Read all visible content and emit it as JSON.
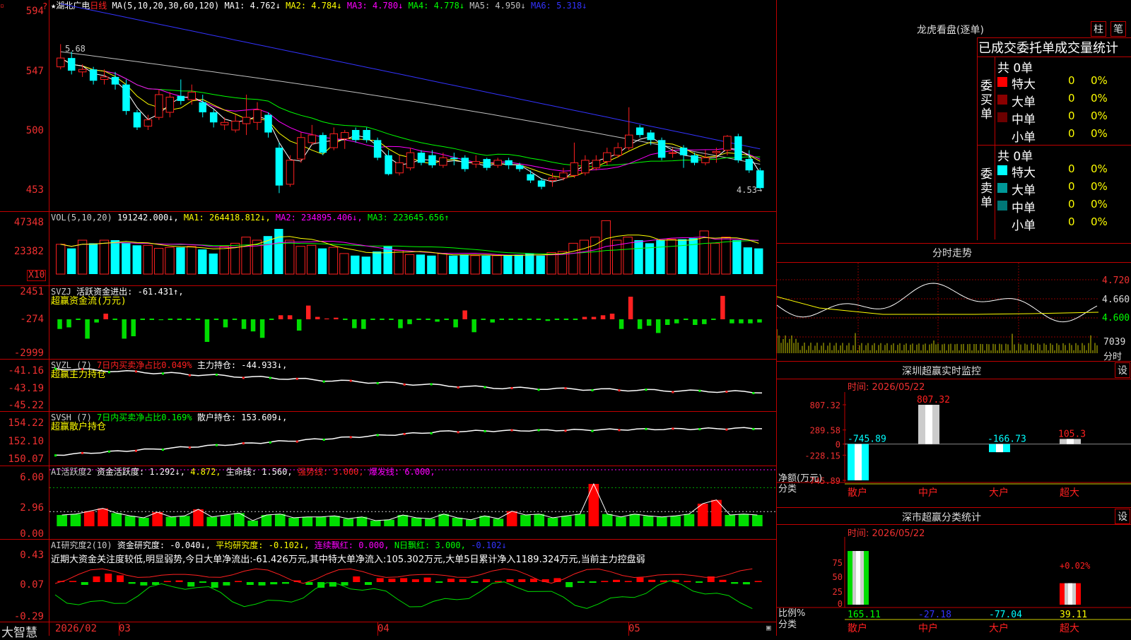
{
  "kline": {
    "star": "★",
    "name": "湖北广电",
    "period": "日线",
    "ma_label": "MA(5,10,20,30,60,120)",
    "ma": [
      {
        "label": "MA1: 4.762↓",
        "color": "#ffffff"
      },
      {
        "label": "MA2: 4.784↓",
        "color": "#ffff00"
      },
      {
        "label": "MA3: 4.780↓",
        "color": "#ff00ff"
      },
      {
        "label": "MA4: 4.778↓",
        "color": "#00ff00"
      },
      {
        "label": "MA5: 4.950↓",
        "color": "#c0c0c0"
      },
      {
        "label": "MA6: 5.318↓",
        "color": "#3333ff"
      }
    ],
    "y_ticks": [
      "594",
      "547",
      "500",
      "453"
    ],
    "high_mark": "5.68",
    "low_mark": "4.53→",
    "candles": [
      {
        "o": 5.5,
        "c": 5.57,
        "h": 5.68,
        "l": 5.48
      },
      {
        "o": 5.57,
        "c": 5.47,
        "h": 5.62,
        "l": 5.44
      },
      {
        "o": 5.46,
        "c": 5.48,
        "h": 5.52,
        "l": 5.42
      },
      {
        "o": 5.48,
        "c": 5.39,
        "h": 5.5,
        "l": 5.36
      },
      {
        "o": 5.4,
        "c": 5.42,
        "h": 5.48,
        "l": 5.36
      },
      {
        "o": 5.42,
        "c": 5.36,
        "h": 5.46,
        "l": 5.32
      },
      {
        "o": 5.36,
        "c": 5.15,
        "h": 5.4,
        "l": 5.12
      },
      {
        "o": 5.14,
        "c": 5.02,
        "h": 5.16,
        "l": 5.0
      },
      {
        "o": 5.03,
        "c": 5.08,
        "h": 5.12,
        "l": 5.0
      },
      {
        "o": 5.1,
        "c": 5.28,
        "h": 5.32,
        "l": 5.08
      },
      {
        "o": 5.14,
        "c": 5.26,
        "h": 5.3,
        "l": 5.1
      },
      {
        "o": 5.27,
        "c": 5.23,
        "h": 5.4,
        "l": 5.2
      },
      {
        "o": 5.24,
        "c": 5.3,
        "h": 5.36,
        "l": 5.2
      },
      {
        "o": 5.22,
        "c": 5.14,
        "h": 5.28,
        "l": 5.1
      },
      {
        "o": 5.14,
        "c": 5.06,
        "h": 5.16,
        "l": 5.02
      },
      {
        "o": 5.04,
        "c": 5.06,
        "h": 5.1,
        "l": 5.0
      },
      {
        "o": 5.0,
        "c": 5.07,
        "h": 5.12,
        "l": 4.98
      },
      {
        "o": 5.05,
        "c": 5.1,
        "h": 5.28,
        "l": 4.96
      },
      {
        "o": 5.06,
        "c": 5.16,
        "h": 5.22,
        "l": 5.0
      },
      {
        "o": 5.12,
        "c": 4.98,
        "h": 5.14,
        "l": 4.94
      },
      {
        "o": 4.86,
        "c": 4.56,
        "h": 4.9,
        "l": 4.5
      },
      {
        "o": 4.57,
        "c": 4.76,
        "h": 4.8,
        "l": 4.55
      },
      {
        "o": 4.77,
        "c": 4.94,
        "h": 4.98,
        "l": 4.74
      },
      {
        "o": 4.9,
        "c": 4.96,
        "h": 5.04,
        "l": 4.88
      },
      {
        "o": 4.96,
        "c": 4.82,
        "h": 4.98,
        "l": 4.8
      },
      {
        "o": 4.86,
        "c": 4.97,
        "h": 5.02,
        "l": 4.84
      },
      {
        "o": 4.93,
        "c": 4.98,
        "h": 5.0,
        "l": 4.85
      },
      {
        "o": 5.0,
        "c": 4.92,
        "h": 5.02,
        "l": 4.9
      },
      {
        "o": 5.0,
        "c": 4.92,
        "h": 5.02,
        "l": 4.9
      },
      {
        "o": 4.92,
        "c": 4.78,
        "h": 4.94,
        "l": 4.76
      },
      {
        "o": 4.8,
        "c": 4.65,
        "h": 4.84,
        "l": 4.64
      },
      {
        "o": 4.66,
        "c": 4.74,
        "h": 4.8,
        "l": 4.64
      },
      {
        "o": 4.7,
        "c": 4.82,
        "h": 4.86,
        "l": 4.68
      },
      {
        "o": 4.82,
        "c": 4.74,
        "h": 4.84,
        "l": 4.72
      },
      {
        "o": 4.8,
        "c": 4.72,
        "h": 4.84,
        "l": 4.7
      },
      {
        "o": 4.72,
        "c": 4.78,
        "h": 4.82,
        "l": 4.7
      },
      {
        "o": 4.78,
        "c": 4.77,
        "h": 4.82,
        "l": 4.72
      },
      {
        "o": 4.78,
        "c": 4.69,
        "h": 4.8,
        "l": 4.67
      },
      {
        "o": 4.73,
        "c": 4.75,
        "h": 4.8,
        "l": 4.7
      },
      {
        "o": 4.77,
        "c": 4.7,
        "h": 4.78,
        "l": 4.68
      },
      {
        "o": 4.72,
        "c": 4.76,
        "h": 4.78,
        "l": 4.7
      },
      {
        "o": 4.76,
        "c": 4.72,
        "h": 4.78,
        "l": 4.69
      },
      {
        "o": 4.72,
        "c": 4.69,
        "h": 4.74,
        "l": 4.67
      },
      {
        "o": 4.65,
        "c": 4.6,
        "h": 4.68,
        "l": 4.58
      },
      {
        "o": 4.6,
        "c": 4.55,
        "h": 4.62,
        "l": 4.53
      },
      {
        "o": 4.6,
        "c": 4.62,
        "h": 4.66,
        "l": 4.55
      },
      {
        "o": 4.62,
        "c": 4.66,
        "h": 4.7,
        "l": 4.6
      },
      {
        "o": 4.64,
        "c": 4.74,
        "h": 4.9,
        "l": 4.62
      },
      {
        "o": 4.66,
        "c": 4.76,
        "h": 4.8,
        "l": 4.64
      },
      {
        "o": 4.7,
        "c": 4.76,
        "h": 4.8,
        "l": 4.68
      },
      {
        "o": 4.75,
        "c": 4.82,
        "h": 4.86,
        "l": 4.72
      },
      {
        "o": 4.8,
        "c": 4.86,
        "h": 4.9,
        "l": 4.78
      },
      {
        "o": 4.86,
        "c": 4.96,
        "h": 5.18,
        "l": 4.84
      },
      {
        "o": 5.02,
        "c": 4.96,
        "h": 5.04,
        "l": 4.94
      },
      {
        "o": 4.98,
        "c": 4.92,
        "h": 5.0,
        "l": 4.88
      },
      {
        "o": 4.92,
        "c": 4.78,
        "h": 4.94,
        "l": 4.76
      },
      {
        "o": 4.82,
        "c": 4.82,
        "h": 4.86,
        "l": 4.78
      },
      {
        "o": 4.86,
        "c": 4.8,
        "h": 4.88,
        "l": 4.7
      },
      {
        "o": 4.8,
        "c": 4.74,
        "h": 4.82,
        "l": 4.72
      },
      {
        "o": 4.74,
        "c": 4.78,
        "h": 4.84,
        "l": 4.72
      },
      {
        "o": 4.82,
        "c": 4.83,
        "h": 4.86,
        "l": 4.74
      },
      {
        "o": 4.84,
        "c": 4.95,
        "h": 4.96,
        "l": 4.8
      },
      {
        "o": 4.95,
        "c": 4.76,
        "h": 4.97,
        "l": 4.74
      },
      {
        "o": 4.77,
        "c": 4.68,
        "h": 4.84,
        "l": 4.66
      },
      {
        "o": 4.68,
        "c": 4.54,
        "h": 4.7,
        "l": 4.53
      }
    ]
  },
  "vol": {
    "label": "VOL(5,10,20)",
    "value": "191242.000↓,",
    "ma": [
      {
        "label": "MA1: 264418.812↓,",
        "color": "#ffff00"
      },
      {
        "label": "MA2: 234895.406↓,",
        "color": "#ff00ff"
      },
      {
        "label": "MA3: 223645.656↑",
        "color": "#00ff00"
      }
    ],
    "y_ticks": [
      "47348",
      "23382"
    ],
    "unit": "X10",
    "values": [
      29,
      25,
      33,
      30,
      33,
      33,
      30,
      28,
      28,
      25,
      26,
      26,
      27,
      24,
      20,
      27,
      30,
      36,
      33,
      37,
      44,
      33,
      27,
      28,
      25,
      26,
      20,
      18,
      17,
      22,
      27,
      23,
      19,
      19,
      18,
      20,
      18,
      19,
      18,
      18,
      18,
      18,
      19,
      20,
      18,
      21,
      22,
      30,
      33,
      36,
      52,
      33,
      36,
      33,
      30,
      33,
      34,
      34,
      35,
      42,
      30,
      36,
      33,
      26,
      25
    ]
  },
  "svzj": {
    "label": "SVZJ",
    "text": "活跃资金进出: -61.431↑,",
    "subtitle": "超赢资金流(万元)",
    "y_ticks": [
      "2451",
      "-274",
      "-2999"
    ],
    "values": [
      -1200,
      -1000,
      0,
      -2400,
      -400,
      700,
      0,
      -2400,
      -2100,
      0,
      0,
      -100,
      0,
      0,
      0,
      0,
      -2800,
      0,
      -1000,
      0,
      -1200,
      -1500,
      -2300,
      0,
      500,
      500,
      -1400,
      1700,
      300,
      100,
      200,
      0,
      -1100,
      -1200,
      0,
      0,
      0,
      -1100,
      -600,
      0,
      0,
      -300,
      0,
      -1000,
      1100,
      -1600,
      0,
      -400,
      0,
      0,
      0,
      0,
      0,
      -200,
      0,
      0,
      0,
      300,
      300,
      500,
      700,
      -1200,
      2800,
      -1200,
      -800,
      -1700,
      -700,
      -500,
      0,
      -700,
      -600,
      0,
      2900,
      -500,
      -500,
      -500,
      -400
    ]
  },
  "svzl": {
    "label": "SVZL (7)",
    "ratio": "7日内买卖净占比0.049%",
    "text": "主力持仓: -44.933↓,",
    "subtitle": "超赢主力持仓",
    "y_ticks": [
      "-41.16",
      "-43.19",
      "-45.22"
    ]
  },
  "svsh": {
    "label": "SVSH (7)",
    "ratio": "7日内买卖净占比0.169%",
    "text": "散户持仓: 153.609↓,",
    "subtitle": "超赢散户持仓",
    "y_ticks": [
      "154.22",
      "152.10",
      "150.07"
    ]
  },
  "ai_active": {
    "label": "AI活跃度2",
    "text1": "资金活跃度: 1.292↓,",
    "text2": "4.872,",
    "text3": "生命线: 1.560,",
    "text4": "强势线: 3.000,",
    "text5": "爆发线: 6.000,",
    "y_ticks": [
      "6.00",
      "2.96",
      "0.00"
    ],
    "values": [
      1.2,
      1.3,
      1.6,
      1.9,
      1.4,
      1.1,
      0.9,
      1.5,
      1.0,
      1.1,
      1.8,
      1.0,
      1.2,
      1.4,
      0.6,
      1.2,
      1.3,
      0.9,
      1.0,
      1.0,
      1.1,
      0.8,
      1.0,
      0.6,
      0.7,
      1.2,
      0.9,
      0.8,
      1.3,
      0.9,
      0.7,
      1.1,
      0.8,
      1.6,
      1.2,
      1.3,
      0.9,
      1.1,
      1.3,
      4.5,
      1.3,
      1.0,
      1.3,
      1.1,
      1.0,
      1.1,
      1.3,
      2.4,
      2.8,
      1.2,
      1.3,
      1.2
    ]
  },
  "ai_research": {
    "label": "AI研究度2(10)",
    "text1": "资金研究度: -0.040↓,",
    "text2": "平均研究度: -0.102↓,",
    "text3": "连续飘红: 0.000,",
    "text4": "N日飘红: 3.000,",
    "text5": "-0.102↓",
    "comment": "近期大资金关注度较低,明显弱势,今日大单净流出:-61.426万元,其中特大单净流入:105.302万元,大单5日累计净入1189.324万元,当前主力控盘弱",
    "y_ticks": [
      "0.43",
      "0.07",
      "-0.29"
    ],
    "values": [
      0.02,
      0.02,
      -0.05,
      0.1,
      0.15,
      0.12,
      -0.03,
      -0.06,
      -0.05,
      0.02,
      0.03,
      -0.08,
      0.0,
      -0.1,
      -0.06,
      0.02,
      -0.05,
      -0.06,
      -0.04,
      -0.03,
      0.03,
      -0.05,
      -0.1,
      -0.08,
      -0.06,
      0.1,
      -0.05,
      0.07,
      0.06,
      0.07,
      0.05,
      0.08,
      0.0,
      0.06,
      0.05,
      0.0,
      0.05,
      0.02,
      0.05,
      0.05,
      0.06,
      0.05,
      0.07,
      -0.09,
      0.0,
      0.0,
      0.02,
      0.04,
      0.02,
      0.08,
      0.04,
      0.03,
      0.04,
      0.02,
      0.0,
      0.1,
      0.04,
      -0.03,
      -0.04,
      0.02
    ]
  },
  "xaxis": {
    "footer_brand": "大智慧",
    "labels": [
      "2026/02",
      "03",
      "04",
      "05"
    ]
  },
  "right": {
    "dragon_title": "龙虎看盘(逐单)",
    "tab_bar": "柱",
    "tab_tick": "笔",
    "stat_header": "已成交委托单成交量统计",
    "buy_total": "共 0单",
    "sell_total": "共 0单",
    "buy_side": "委买单",
    "sell_side": "委卖单",
    "buy_rows": [
      {
        "name": "特大",
        "vol": "0",
        "pct": "0%",
        "color": "#ff0000"
      },
      {
        "name": "大单",
        "vol": "0",
        "pct": "0%",
        "color": "#8b0000"
      },
      {
        "name": "中单",
        "vol": "0",
        "pct": "0%",
        "color": "#6b0000"
      },
      {
        "name": "小单",
        "vol": "0",
        "pct": "0%",
        "color": ""
      }
    ],
    "sell_rows": [
      {
        "name": "特大",
        "vol": "0",
        "pct": "0%",
        "color": "#00ffff"
      },
      {
        "name": "大单",
        "vol": "0",
        "pct": "0%",
        "color": "#009999"
      },
      {
        "name": "中单",
        "vol": "0",
        "pct": "0%",
        "color": "#007777"
      },
      {
        "name": "小单",
        "vol": "0",
        "pct": "0%",
        "color": ""
      }
    ],
    "fenshi_title": "分时走势",
    "fenshi_ticks": [
      "4.720",
      "4.660",
      "4.600"
    ],
    "fenshi_vol": "7039",
    "fenshi_vol_unit": "分时",
    "monitor_title": "深圳超赢实时监控",
    "monitor_set": "设",
    "monitor_time": "时间: 2026/05/22",
    "monitor_ticks": [
      "807.32",
      "289.58",
      "0",
      "-228.15",
      "-745.89"
    ],
    "monitor_axis_title": "净额(万元)",
    "monitor_axis_sub": "分类",
    "monitor_cats": [
      "散户",
      "中户",
      "大户",
      "超大"
    ],
    "monitor_values": [
      -745.89,
      807.32,
      -166.73,
      105.3
    ],
    "monitor_labels": [
      "-745.89",
      "807.32",
      "-166.73",
      "105.3"
    ],
    "class_title": "深市超赢分类统计",
    "class_set": "设",
    "class_time": "时间: 2026/05/22",
    "class_ticks": [
      "75",
      "50",
      "25",
      "0"
    ],
    "class_axis_title": "比例%",
    "class_axis_sub": "分类",
    "class_cats": [
      "散户",
      "中户",
      "大户",
      "超大"
    ],
    "class_bottom": [
      "165.11",
      "-27.18",
      "-77.04",
      "39.11"
    ],
    "class_pct_label": "+0.02%",
    "class_fill": [
      1.0,
      0,
      0,
      0.4
    ]
  },
  "colors": {
    "up": "#ff2020",
    "down": "#00ffff",
    "grid": "#c00000",
    "axis_text": "#f03030"
  }
}
